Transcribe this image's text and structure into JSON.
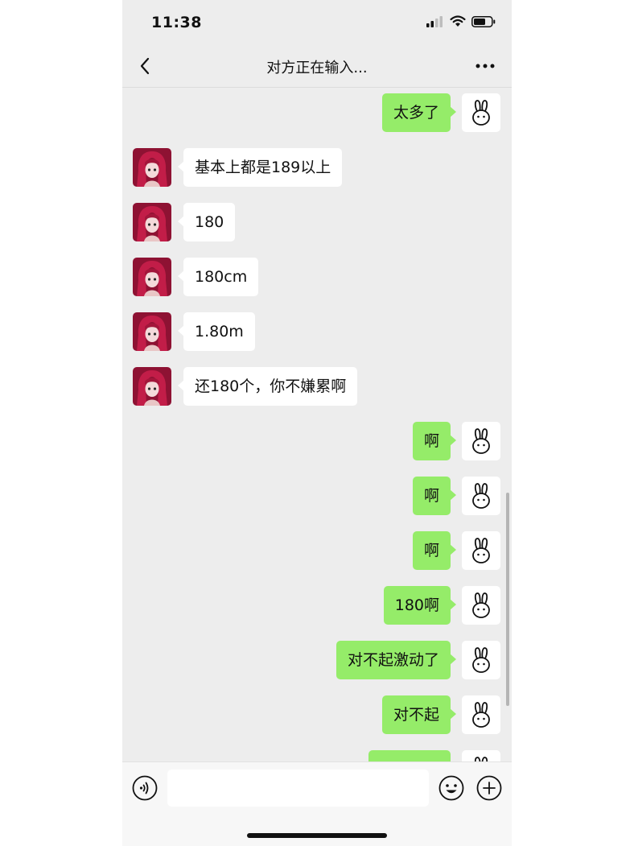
{
  "status_bar": {
    "time": "11:38"
  },
  "nav": {
    "title": "对方正在输入..."
  },
  "messages": [
    {
      "from": "me",
      "text": "太多了"
    },
    {
      "from": "them",
      "text": "基本上都是189以上"
    },
    {
      "from": "them",
      "text": "180"
    },
    {
      "from": "them",
      "text": "180cm"
    },
    {
      "from": "them",
      "text": "1.80m"
    },
    {
      "from": "them",
      "text": "还180个，你不嫌累啊"
    },
    {
      "from": "me",
      "text": "啊"
    },
    {
      "from": "me",
      "text": "啊"
    },
    {
      "from": "me",
      "text": "啊"
    },
    {
      "from": "me",
      "text": "180啊"
    },
    {
      "from": "me",
      "text": "对不起激动了"
    },
    {
      "from": "me",
      "text": "对不起"
    },
    {
      "from": "me",
      "text": ""
    }
  ],
  "input": {
    "value": "",
    "placeholder": ""
  },
  "icons": {
    "back": "chevron-left-icon",
    "more": "more-dots-icon",
    "voice": "voice-icon",
    "emoji": "emoji-icon",
    "plus": "plus-icon",
    "my_avatar": "rabbit-icon"
  },
  "colors": {
    "my_bubble": "#95ec69",
    "their_bubble": "#ffffff",
    "background": "#ededed"
  }
}
